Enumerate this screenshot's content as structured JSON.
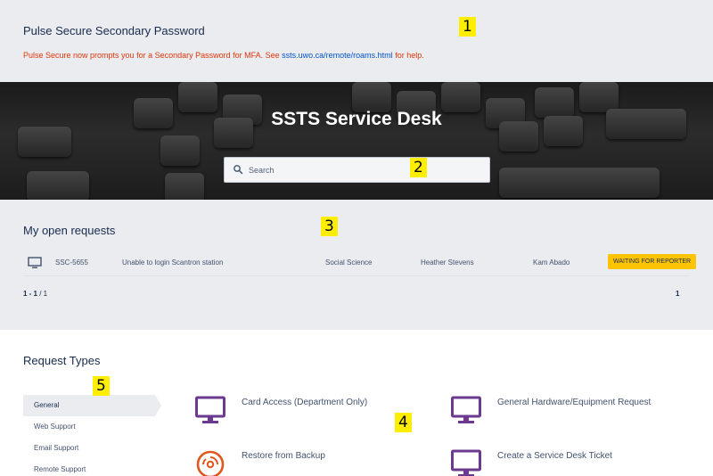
{
  "markers": [
    "1",
    "2",
    "3",
    "4",
    "5"
  ],
  "announcement": {
    "title": "Pulse Secure Secondary Password",
    "text_before": "Pulse Secure now prompts you for a Secondary Password for MFA. See ",
    "link_text": "ssts.uwo.ca/remote/roams.html",
    "text_after": " for help.",
    "text_color": "#de350b",
    "link_color": "#0052cc"
  },
  "hero": {
    "title": "SSTS Service Desk",
    "search_placeholder": "Search"
  },
  "open_requests": {
    "heading": "My open requests",
    "rows": [
      {
        "icon": "monitor-icon",
        "key": "SSC-5655",
        "summary": "Unable to login Scantron station",
        "department": "Social Science",
        "reporter": "Heather Stevens",
        "assignee": "Kam Abado",
        "status": "WAITING FOR REPORTER",
        "status_color": "#ffc400"
      }
    ],
    "pager": {
      "range": "1 - 1",
      "total": " / 1",
      "page": "1"
    }
  },
  "request_types": {
    "heading": "Request Types",
    "nav": [
      "General",
      "Web Support",
      "Email Support",
      "Remote Support"
    ],
    "active_nav": "General",
    "items": [
      {
        "label": "Card Access (Department Only)",
        "icon": "monitor-icon"
      },
      {
        "label": "General Hardware/Equipment Request",
        "icon": "monitor-icon"
      },
      {
        "label": "Restore from Backup",
        "icon": "backup-disc-icon"
      },
      {
        "label": "Create a Service Desk Ticket",
        "icon": "monitor-icon"
      }
    ],
    "icon_purple": "#6b3a8f",
    "icon_orange": "#e2561e"
  }
}
